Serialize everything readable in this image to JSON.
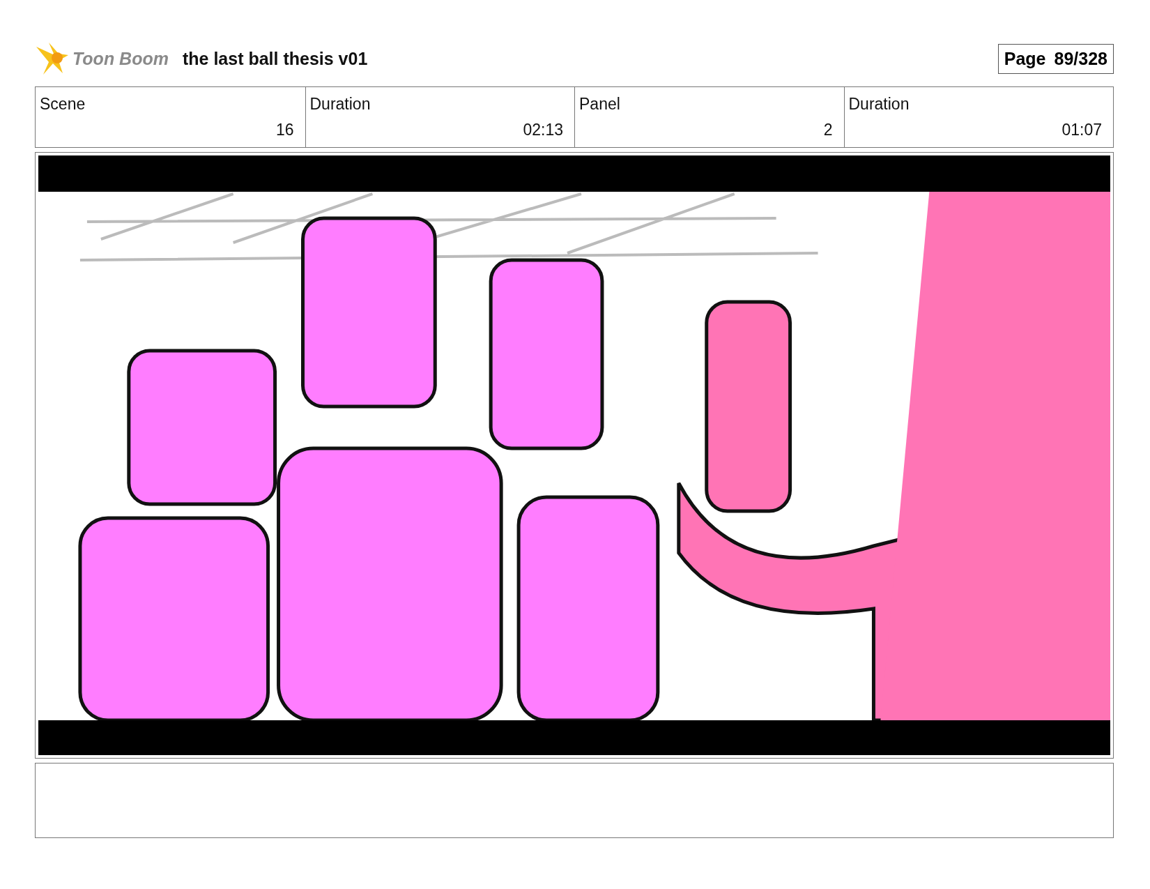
{
  "header": {
    "logo_text": "Toon Boom",
    "title": "the last ball thesis v01",
    "page_label": "Page",
    "page_number": "89/328"
  },
  "info": [
    {
      "label": "Scene",
      "value": "16"
    },
    {
      "label": "Duration",
      "value": "02:13"
    },
    {
      "label": "Panel",
      "value": "2"
    },
    {
      "label": "Duration",
      "value": "01:07"
    }
  ]
}
